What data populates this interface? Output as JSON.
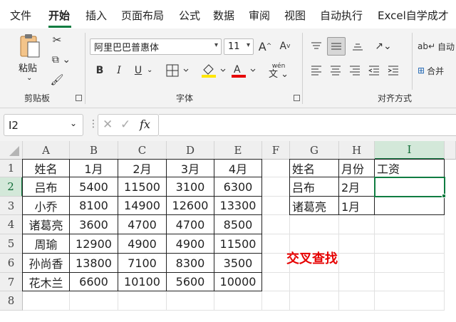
{
  "tabs": [
    "文件",
    "开始",
    "插入",
    "页面布局",
    "公式",
    "数据",
    "审阅",
    "视图",
    "自动执行",
    "Excel自学成才"
  ],
  "ribbon": {
    "clipboard": {
      "paste_label": "粘贴",
      "group_label": "剪贴板"
    },
    "font": {
      "font_name": "阿里巴巴普惠体",
      "font_size": "11",
      "bold": "B",
      "italic": "I",
      "underline": "U",
      "pinyin": "wén",
      "group_label": "字体"
    },
    "alignment": {
      "autowrap_label": "自动",
      "merge_label": "合并",
      "group_label": "对齐方式"
    }
  },
  "formula_bar": {
    "name_box": "I2",
    "fx": "fx",
    "formula": ""
  },
  "grid": {
    "columns": [
      "A",
      "B",
      "C",
      "D",
      "E",
      "F",
      "G",
      "H",
      "I"
    ],
    "rows": [
      "1",
      "2",
      "3",
      "4",
      "5",
      "6",
      "7",
      "8"
    ],
    "selected_cell": "I2",
    "main_table": {
      "header": [
        "姓名",
        "1月",
        "2月",
        "3月",
        "4月"
      ],
      "rows": [
        [
          "吕布",
          "5400",
          "11500",
          "3100",
          "6300"
        ],
        [
          "小乔",
          "8100",
          "14900",
          "12600",
          "13300"
        ],
        [
          "诸葛亮",
          "3600",
          "4700",
          "4700",
          "8500"
        ],
        [
          "周瑜",
          "12900",
          "4900",
          "4900",
          "11500"
        ],
        [
          "孙尚香",
          "13800",
          "7100",
          "8300",
          "3500"
        ],
        [
          "花木兰",
          "6600",
          "10100",
          "5600",
          "10000"
        ]
      ]
    },
    "lookup_table": {
      "header": [
        "姓名",
        "月份",
        "工资"
      ],
      "rows": [
        [
          "吕布",
          "2月",
          ""
        ],
        [
          "诸葛亮",
          "1月",
          ""
        ]
      ]
    },
    "annotation": "交叉查找"
  },
  "colors": {
    "accent": "#107c41",
    "annotation": "#e60000"
  }
}
